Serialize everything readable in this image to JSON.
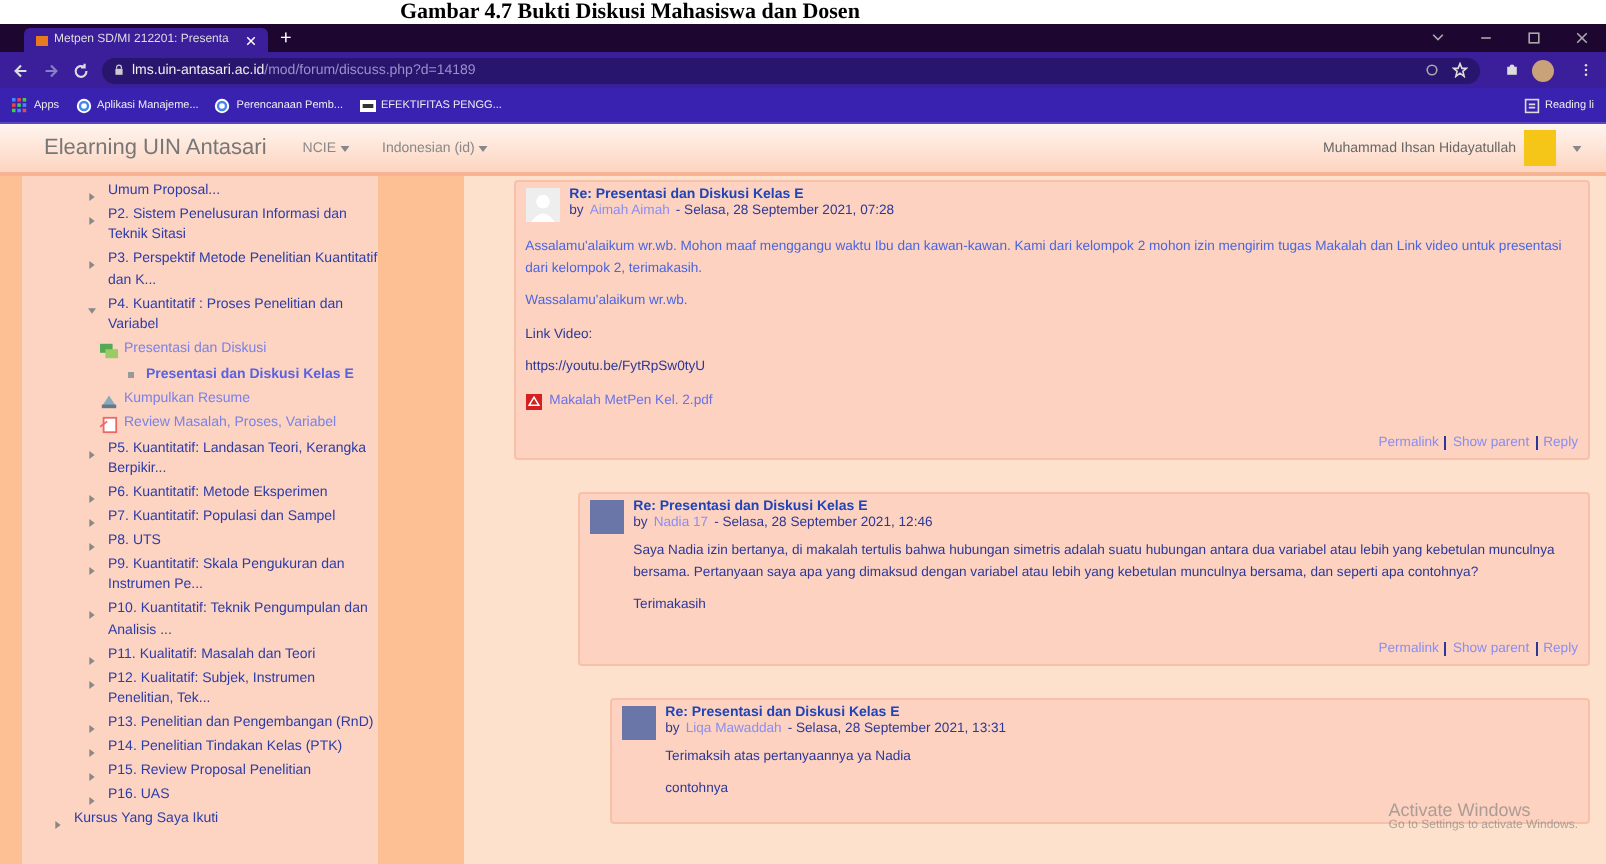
{
  "caption": "Gambar 4.7 Bukti Diskusi Mahasiswa dan Dosen",
  "browser": {
    "tabs": [
      {
        "title": "Metpen SD/MI 212201: Presenta",
        "selected": true
      }
    ],
    "new_tab": "+",
    "url_host": "lms.uin-antasari.ac.id",
    "url_path": "/mod/forum/discuss.php?d=14189",
    "bookmarks": [
      {
        "kind": "apps",
        "label": "Apps"
      },
      {
        "kind": "google",
        "label": "Aplikasi Manajeme..."
      },
      {
        "kind": "google",
        "label": "Perencanaan Pemb..."
      },
      {
        "kind": "site",
        "label": "EFEKTIFITAS PENGG..."
      }
    ],
    "reading_list": "Reading li"
  },
  "navbar": {
    "brand": "Elearning UIN Antasari",
    "menus": [
      "NCIE",
      "Indonesian (id)"
    ],
    "user": "Muhammad Ihsan Hidayatullah"
  },
  "sidebar": {
    "sections": [
      {
        "label": "Umum Proposal...",
        "expanded": false
      },
      {
        "label": "P2. Sistem Penelusuran Informasi dan Teknik Sitasi",
        "expanded": false
      },
      {
        "label": "P3. Perspektif Metode Penelitian Kuantitatif dan K...",
        "expanded": false
      },
      {
        "label": "P4. Kuantitatif : Proses Penelitian dan Variabel",
        "expanded": true,
        "children": [
          {
            "kind": "forum",
            "label": "Presentasi dan Diskusi",
            "children": [
              {
                "label": "Presentasi dan Diskusi Kelas E",
                "selected": true
              }
            ]
          },
          {
            "kind": "assignment",
            "label": "Kumpulkan Resume"
          },
          {
            "kind": "lesson",
            "label": "Review Masalah, Proses, Variabel"
          }
        ]
      },
      {
        "label": "P5. Kuantitatif: Landasan Teori, Kerangka Berpikir...",
        "expanded": false
      },
      {
        "label": "P6. Kuantitatif: Metode Eksperimen",
        "expanded": false
      },
      {
        "label": "P7. Kuantitatif: Populasi dan Sampel",
        "expanded": false
      },
      {
        "label": "P8. UTS",
        "expanded": false
      },
      {
        "label": "P9. Kuantitatif: Skala Pengukuran dan Instrumen Pe...",
        "expanded": false
      },
      {
        "label": "P10. Kuantitatif: Teknik Pengumpulan dan Analisis ...",
        "expanded": false
      },
      {
        "label": "P11. Kualitatif: Masalah dan Teori",
        "expanded": false
      },
      {
        "label": "P12. Kualitatif: Subjek, Instrumen Penelitian, Tek...",
        "expanded": false
      },
      {
        "label": "P13. Penelitian dan Pengembangan (RnD)",
        "expanded": false
      },
      {
        "label": "P14. Penelitian Tindakan Kelas (PTK)",
        "expanded": false
      },
      {
        "label": "P15. Review Proposal Penelitian",
        "expanded": false
      },
      {
        "label": "P16. UAS",
        "expanded": false
      }
    ],
    "my_courses": {
      "label": "Kursus Yang Saya Ikuti",
      "expanded": false
    }
  },
  "posts": [
    {
      "subject": "Re: Presentasi dan Diskusi Kelas E",
      "by": "by",
      "author": "Aimah Aimah",
      "date": "- Selasa, 28 September 2021, 07:28",
      "avatar": {
        "kind": "default"
      },
      "body": [
        {
          "kind": "highlight",
          "text": "Assalamu'alaikum wr.wb. Mohon maaf menggangu waktu Ibu dan kawan-kawan. Kami dari kelompok 2 mohon izin mengirim tugas Makalah dan Link video untuk presentasi dari kelompok 2, terimakasih."
        },
        {
          "kind": "highlight",
          "text": "Wassalamu'alaikum wr.wb."
        },
        {
          "kind": "text",
          "text": "Link Video:"
        },
        {
          "kind": "text",
          "text": "https://youtu.be/FytRpSw0tyU"
        },
        {
          "kind": "attachment",
          "text": "Makalah MetPen Kel. 2.pdf"
        }
      ],
      "actions": [
        "Permalink",
        "Show parent",
        "Reply"
      ],
      "children": [
        {
          "subject": "Re: Presentasi dan Diskusi Kelas E",
          "by": "by",
          "author": "Nadia 17",
          "date": "- Selasa, 28 September 2021, 12:46",
          "avatar": {
            "kind": "photo"
          },
          "body": [
            {
              "kind": "text",
              "text": "Saya Nadia izin bertanya, di makalah tertulis bahwa hubungan simetris adalah suatu hubungan antara dua variabel atau lebih yang kebetulan munculnya bersama. Pertanyaan saya apa yang dimaksud dengan variabel atau lebih yang kebetulan munculnya bersama, dan seperti apa contohnya?"
            },
            {
              "kind": "text",
              "text": "Terimakasih"
            }
          ],
          "actions": [
            "Permalink",
            "Show parent",
            "Reply"
          ],
          "children": [
            {
              "subject": "Re: Presentasi dan Diskusi Kelas E",
              "by": "by",
              "author": "Liqa Mawaddah",
              "date": "- Selasa, 28 September 2021, 13:31",
              "avatar": {
                "kind": "photo"
              },
              "body": [
                {
                  "kind": "text",
                  "text": "Terimaksih atas pertanyaannya ya Nadia"
                },
                {
                  "kind": "text",
                  "text": "contohnya"
                }
              ]
            }
          ]
        }
      ]
    }
  ],
  "os_notice": {
    "title": "Activate Windows",
    "subtitle": "Go to Settings to activate Windows."
  }
}
